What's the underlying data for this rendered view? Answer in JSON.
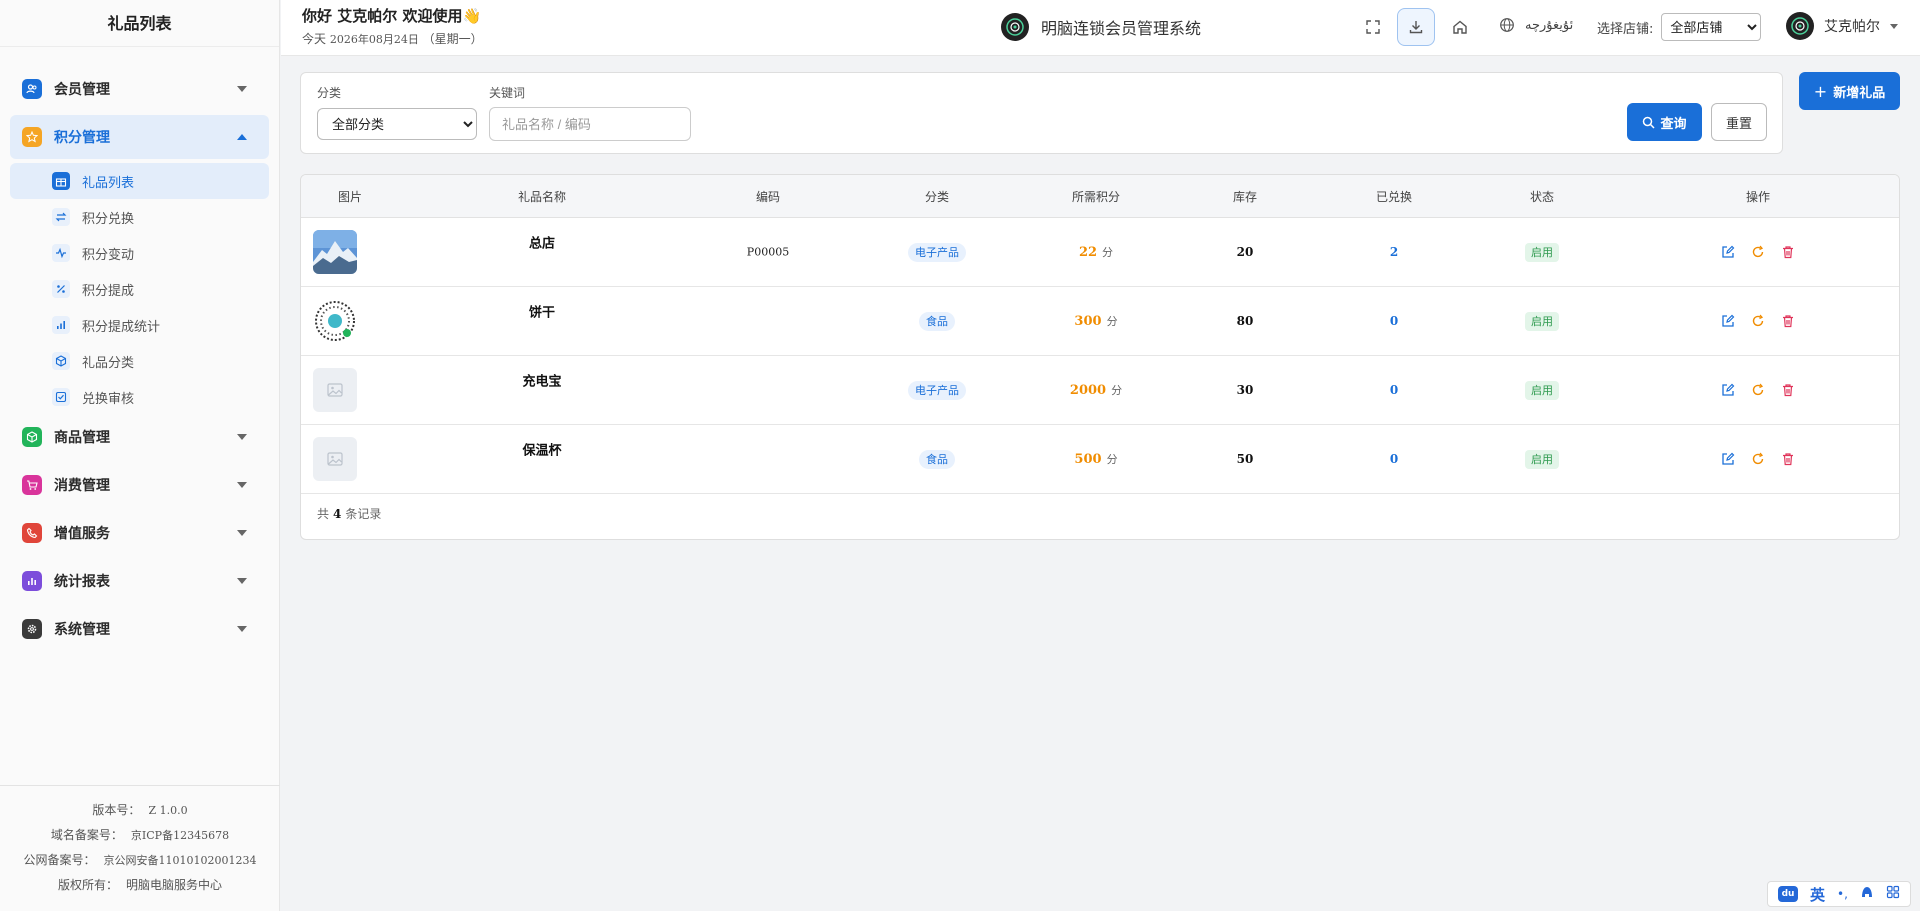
{
  "sidebar": {
    "title": "礼品列表",
    "groups": [
      {
        "label": "会员管理",
        "color": "#1a6fd8",
        "icon": "users-icon"
      },
      {
        "label": "积分管理",
        "color": "#f5a524",
        "icon": "star-icon"
      },
      {
        "label": "商品管理",
        "color": "#22b45a",
        "icon": "cube-icon"
      },
      {
        "label": "消费管理",
        "color": "#d9349b",
        "icon": "cart-icon"
      },
      {
        "label": "增值服务",
        "color": "#e0453a",
        "icon": "phone-icon"
      },
      {
        "label": "统计报表",
        "color": "#7c4ddb",
        "icon": "bar-chart-icon"
      },
      {
        "label": "系统管理",
        "color": "#3a3a3a",
        "icon": "gear-icon"
      }
    ],
    "submenu": [
      {
        "label": "礼品列表",
        "icon": "gift-icon"
      },
      {
        "label": "积分兑换",
        "icon": "exchange-icon"
      },
      {
        "label": "积分变动",
        "icon": "pulse-icon"
      },
      {
        "label": "积分提成",
        "icon": "percent-icon"
      },
      {
        "label": "积分提成统计",
        "icon": "stats-icon"
      },
      {
        "label": "礼品分类",
        "icon": "box-icon"
      },
      {
        "label": "兑换审核",
        "icon": "check-icon"
      }
    ],
    "footer": {
      "version_key": "版本号：",
      "version_val": "Z 1.0.0",
      "icp_key": "域名备案号：",
      "icp_val": "京ICP备12345678",
      "police_key": "公网备案号：",
      "police_val": "京公网安备11010102001234",
      "copyright_key": "版权所有：",
      "copyright_val": "明脑电脑服务中心"
    }
  },
  "header": {
    "greeting": "你好  艾克帕尔  欢迎使用👋",
    "date_prefix": "今天",
    "date": "2026年08月24日",
    "weekday": "（星期一）",
    "brand": "明脑连锁会员管理系统",
    "language": "ئۇيغۇرچە",
    "store_label": "选择店铺:",
    "store_value": "全部店铺",
    "username": "艾克帕尔"
  },
  "filter": {
    "category_label": "分类",
    "category_value": "全部分类",
    "keyword_label": "关键词",
    "keyword_placeholder": "礼品名称 / 编码",
    "query_label": "查询",
    "reset_label": "重置",
    "new_label": "新增礼品"
  },
  "table": {
    "columns": [
      "图片",
      "礼品名称",
      "编码",
      "分类",
      "所需积分",
      "库存",
      "已兑换",
      "状态",
      "操作"
    ],
    "rows": [
      {
        "name": "总店",
        "code": "P00005",
        "category": "电子产品",
        "points": "22",
        "unit": "分",
        "stock": "20",
        "exchanged": "2",
        "status": "启用",
        "image": "mountain-photo"
      },
      {
        "name": "饼干",
        "code": "",
        "category": "食品",
        "points": "300",
        "unit": "分",
        "stock": "80",
        "exchanged": "0",
        "status": "启用",
        "image": "qr-code"
      },
      {
        "name": "充电宝",
        "code": "",
        "category": "电子产品",
        "points": "2000",
        "unit": "分",
        "stock": "30",
        "exchanged": "0",
        "status": "启用",
        "image": "placeholder"
      },
      {
        "name": "保温杯",
        "code": "",
        "category": "食品",
        "points": "500",
        "unit": "分",
        "stock": "50",
        "exchanged": "0",
        "status": "启用",
        "image": "placeholder"
      }
    ],
    "total_prefix": "共",
    "total": "4",
    "total_suffix": "条记录"
  },
  "ime": {
    "brand": "du",
    "mode": "英"
  }
}
